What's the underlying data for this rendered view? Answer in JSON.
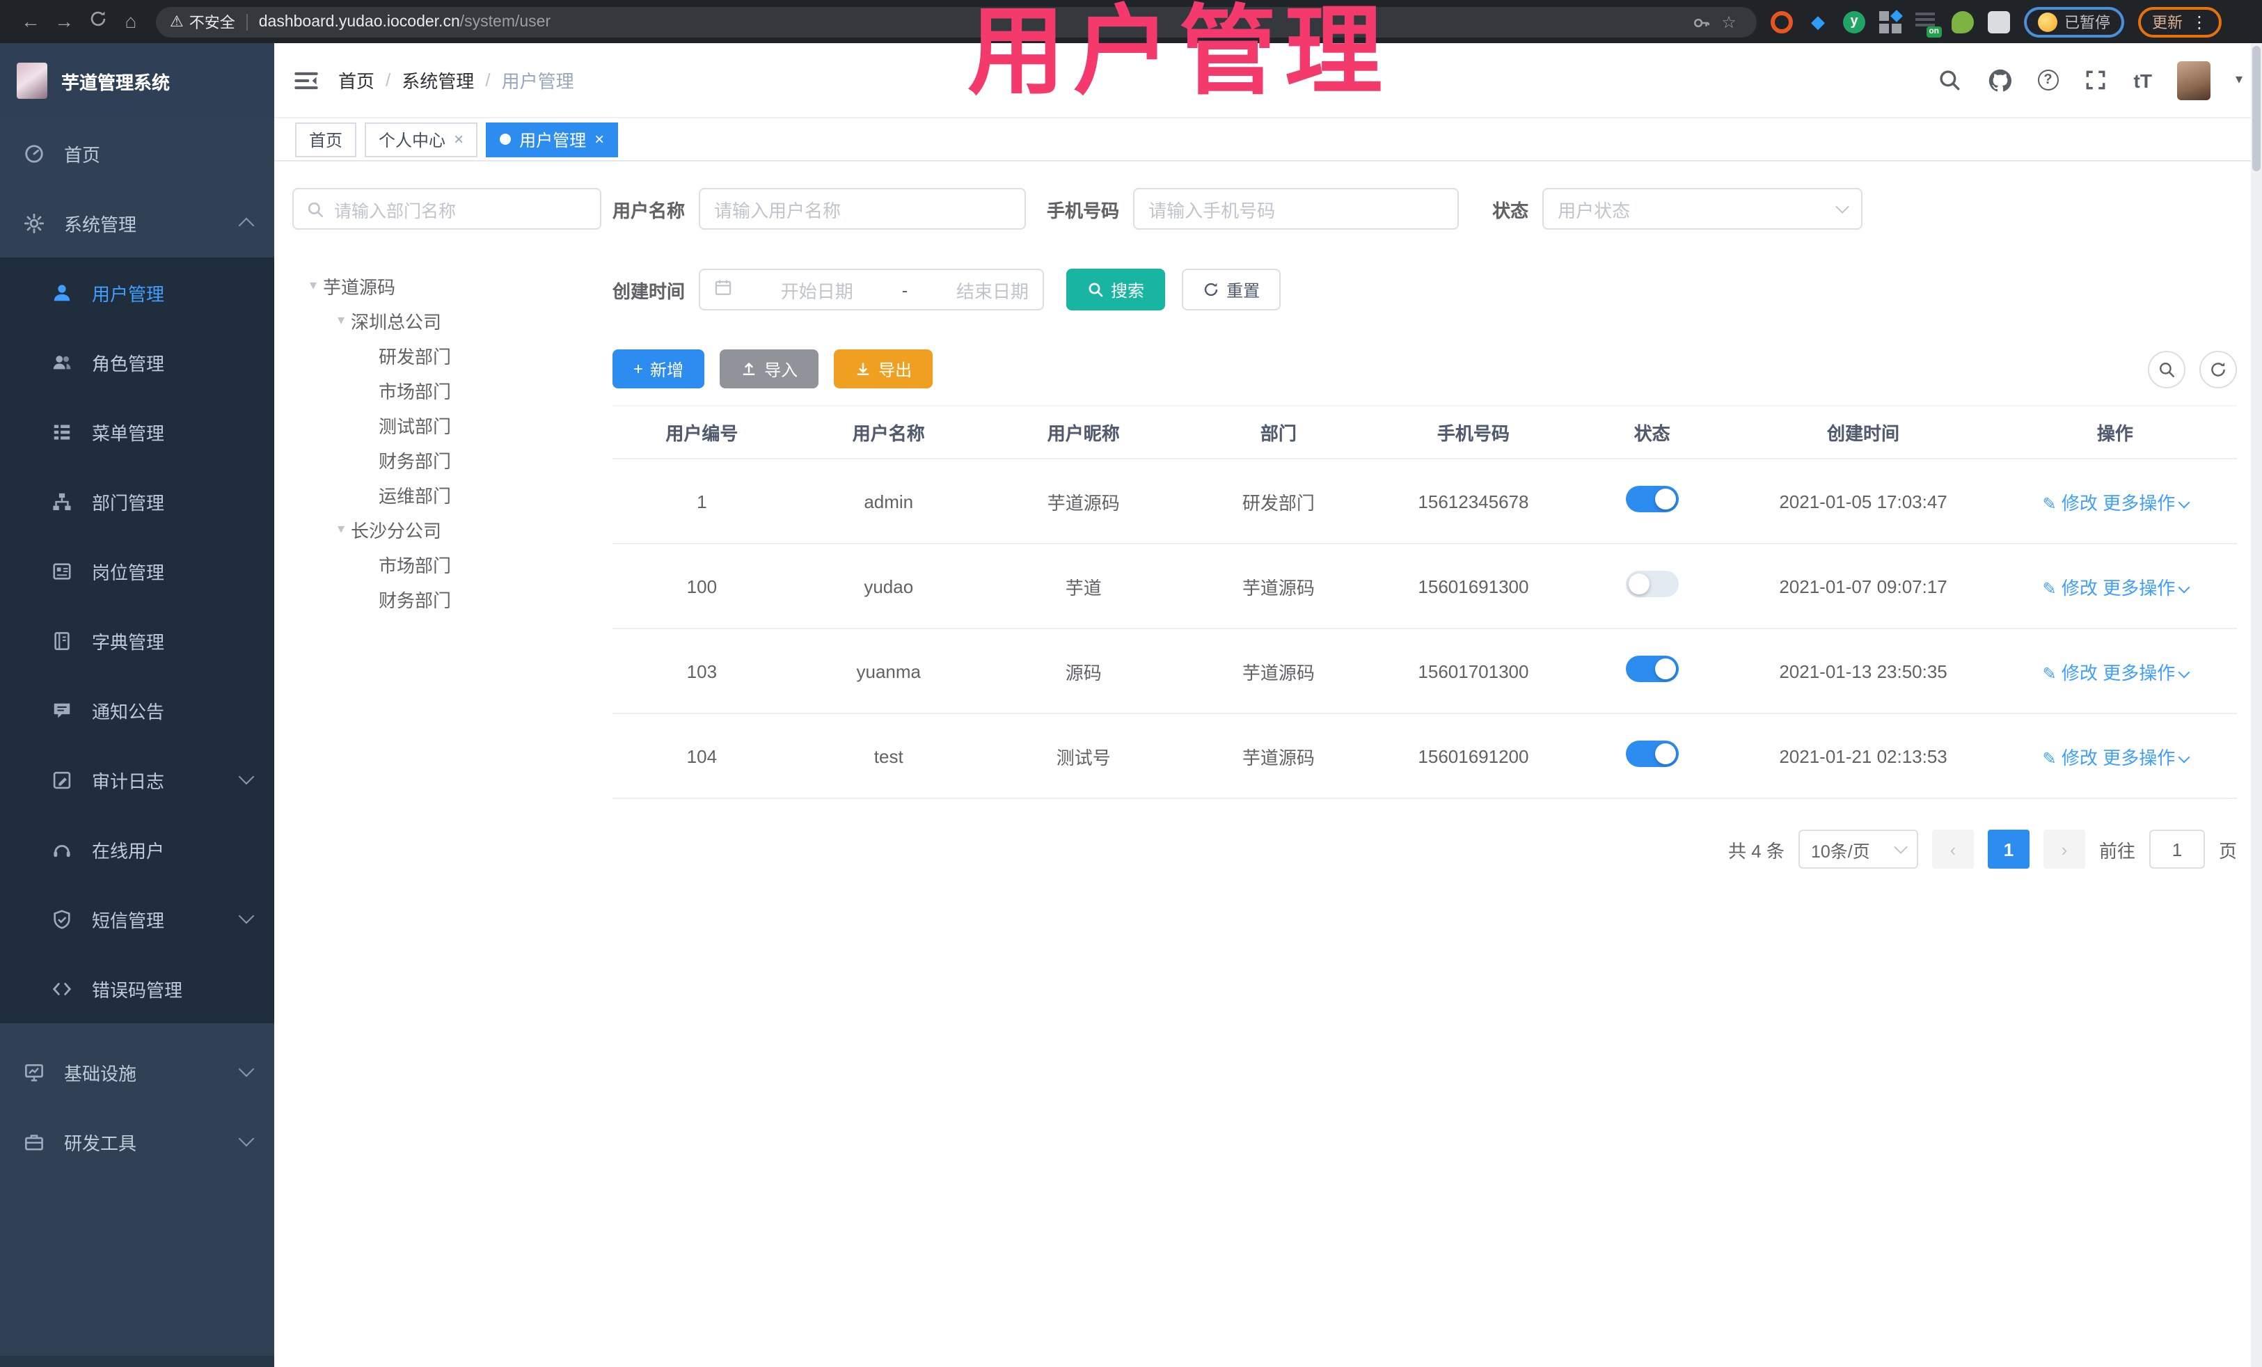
{
  "colors": {
    "primary": "#2d8cf0",
    "link": "#409eff",
    "teal_search": "#19b5a3",
    "export_orange": "#f0a020",
    "import_gray": "#909399",
    "sidebar_bg": "#304156",
    "submenu_bg": "#1f2d3d",
    "annotation_pink": "#f43a6c",
    "active_menu": "#409eff"
  },
  "icons": {
    "back": "←",
    "forward": "→",
    "home": "⌂",
    "warning": "⚠",
    "star": "☆",
    "kebab": "⋮",
    "caret": "▾",
    "tree_caret": "▾",
    "prev": "‹",
    "next": "›",
    "close": "×",
    "edit": "✎",
    "plus": "+",
    "gem": "◆"
  },
  "browser": {
    "security_label": "不安全",
    "url_host": "dashboard.yudao.iocoder.cn",
    "url_path": "/system/user",
    "profile_status": "已暂停",
    "update_label": "更新",
    "extension_badge": "on",
    "yuque_letter": "y"
  },
  "annotation": {
    "title": "用户管理"
  },
  "header": {
    "app_title": "芋道管理系统",
    "breadcrumb": [
      "首页",
      "系统管理",
      "用户管理"
    ],
    "separator": "/",
    "help_glyph": "?",
    "font_size_glyph": "tT"
  },
  "tabs": [
    {
      "label": "首页"
    },
    {
      "label": "个人中心"
    },
    {
      "label": "用户管理"
    }
  ],
  "sidebar": {
    "home": "首页",
    "system": "系统管理",
    "sub": [
      "用户管理",
      "角色管理",
      "菜单管理",
      "部门管理",
      "岗位管理",
      "字典管理",
      "通知公告",
      "审计日志",
      "在线用户",
      "短信管理",
      "错误码管理"
    ],
    "infra": "基础设施",
    "tools": "研发工具"
  },
  "dept": {
    "search_placeholder": "请输入部门名称",
    "root": "芋道源码",
    "branch1": "深圳总公司",
    "branch1_children": [
      "研发部门",
      "市场部门",
      "测试部门",
      "财务部门",
      "运维部门"
    ],
    "branch2": "长沙分公司",
    "branch2_children": [
      "市场部门",
      "财务部门"
    ]
  },
  "filters": {
    "name_label": "用户名称",
    "name_placeholder": "请输入用户名称",
    "mobile_label": "手机号码",
    "mobile_placeholder": "请输入手机号码",
    "status_label": "状态",
    "status_placeholder": "用户状态",
    "time_label": "创建时间",
    "date_start": "开始日期",
    "date_separator": "-",
    "date_end": "结束日期",
    "search_label": "搜索",
    "reset_label": "重置"
  },
  "toolbar": {
    "add_label": "新增",
    "import_label": "导入",
    "export_label": "导出"
  },
  "table": {
    "headers": [
      "用户编号",
      "用户名称",
      "用户昵称",
      "部门",
      "手机号码",
      "状态",
      "创建时间",
      "操作"
    ],
    "ops": {
      "edit": "修改",
      "more": "更多操作"
    },
    "rows": [
      {
        "id": "1",
        "username": "admin",
        "nickname": "芋道源码",
        "dept": "研发部门",
        "mobile": "15612345678",
        "status": "on",
        "created": "2021-01-05 17:03:47"
      },
      {
        "id": "100",
        "username": "yudao",
        "nickname": "芋道",
        "dept": "芋道源码",
        "mobile": "15601691300",
        "status": "off",
        "created": "2021-01-07 09:07:17"
      },
      {
        "id": "103",
        "username": "yuanma",
        "nickname": "源码",
        "dept": "芋道源码",
        "mobile": "15601701300",
        "status": "on",
        "created": "2021-01-13 23:50:35"
      },
      {
        "id": "104",
        "username": "test",
        "nickname": "测试号",
        "dept": "芋道源码",
        "mobile": "15601691200",
        "status": "on",
        "created": "2021-01-21 02:13:53"
      }
    ]
  },
  "pagination": {
    "total_text": "共 4 条",
    "page_size": "10条/页",
    "current_page": "1",
    "goto_label": "前往",
    "goto_value": "1",
    "page_suffix": "页"
  }
}
